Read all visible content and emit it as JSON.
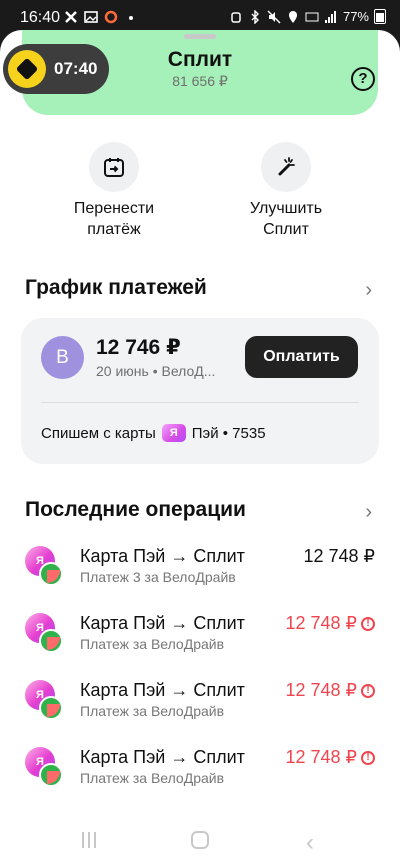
{
  "status_bar": {
    "time": "16:40",
    "battery": "77%"
  },
  "timer": {
    "value": "07:40"
  },
  "header": {
    "title": "Сплит",
    "subtitle": "81 656 ₽"
  },
  "actions": [
    {
      "label_line1": "Перенести",
      "label_line2": "платёж"
    },
    {
      "label_line1": "Улучшить",
      "label_line2": "Сплит"
    }
  ],
  "schedule": {
    "title": "График платежей",
    "avatar_letter": "В",
    "amount": "12 746 ₽",
    "subtitle": "20 июнь • ВелоД...",
    "pay_button": "Оплатить",
    "card_prefix": "Спишем с карты",
    "card_chip": "Я",
    "card_name": "Пэй • 7535"
  },
  "operations": {
    "title": "Последние операции",
    "items": [
      {
        "title": "Карта Пэй → Сплит",
        "subtitle": "Платеж 3 за ВелоДрайв",
        "amount": "12 748 ₽",
        "status": "ok"
      },
      {
        "title": "Карта Пэй → Сплит",
        "subtitle": "Платеж за ВелоДрайв",
        "amount": "12 748 ₽",
        "status": "error"
      },
      {
        "title": "Карта Пэй → Сплит",
        "subtitle": "Платеж за ВелоДрайв",
        "amount": "12 748 ₽",
        "status": "error"
      },
      {
        "title": "Карта Пэй → Сплит",
        "subtitle": "Платеж за ВелоДрайв",
        "amount": "12 748 ₽",
        "status": "error"
      }
    ]
  },
  "colors": {
    "accent_green": "#a6f0b9",
    "error_red": "#f0454f",
    "avatar_purple": "#a091de"
  }
}
